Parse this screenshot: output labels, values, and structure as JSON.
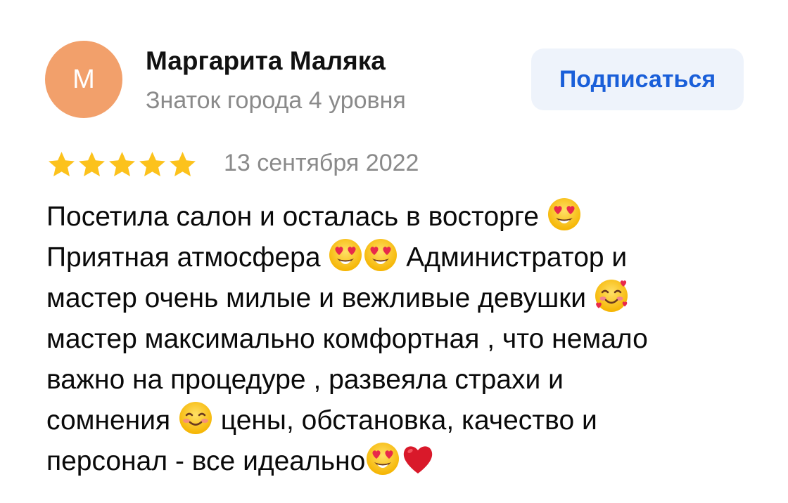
{
  "author": {
    "initial": "М",
    "name": "Маргарита Маляка",
    "level": "Знаток города 4 уровня",
    "avatar_color": "#f2a06b"
  },
  "subscribe": {
    "label": "Подписаться",
    "text_color": "#1a5fd9",
    "background": "#eef3fb"
  },
  "rating": {
    "stars": 5,
    "max": 5,
    "color": "#fcc21c"
  },
  "review": {
    "date": "13 сентября 2022",
    "lines": [
      {
        "segments": [
          {
            "type": "text",
            "value": "Посетила салон и осталась в восторге "
          },
          {
            "type": "emoji",
            "icon": "heart-eyes-emoji-icon"
          }
        ]
      },
      {
        "segments": [
          {
            "type": "text",
            "value": "Приятная атмосфера "
          },
          {
            "type": "emoji",
            "icon": "heart-eyes-emoji-icon"
          },
          {
            "type": "emoji",
            "icon": "heart-eyes-emoji-icon"
          },
          {
            "type": "text",
            "value": " Администратор и"
          }
        ]
      },
      {
        "segments": [
          {
            "type": "text",
            "value": "мастер очень милые и вежливые девушки "
          },
          {
            "type": "emoji",
            "icon": "smiling-face-with-hearts-emoji-icon"
          }
        ]
      },
      {
        "segments": [
          {
            "type": "text",
            "value": "мастер максимально комфортная , что немало"
          }
        ]
      },
      {
        "segments": [
          {
            "type": "text",
            "value": "важно на процедуре , развеяла страхи и"
          }
        ]
      },
      {
        "segments": [
          {
            "type": "text",
            "value": "сомнения "
          },
          {
            "type": "emoji",
            "icon": "smiling-face-emoji-icon"
          },
          {
            "type": "text",
            "value": " цены, обстановка, качество и"
          }
        ]
      },
      {
        "segments": [
          {
            "type": "text",
            "value": "персонал - все идеально"
          },
          {
            "type": "emoji",
            "icon": "heart-eyes-emoji-icon"
          },
          {
            "type": "emoji",
            "icon": "red-heart-emoji-icon"
          }
        ]
      }
    ]
  }
}
